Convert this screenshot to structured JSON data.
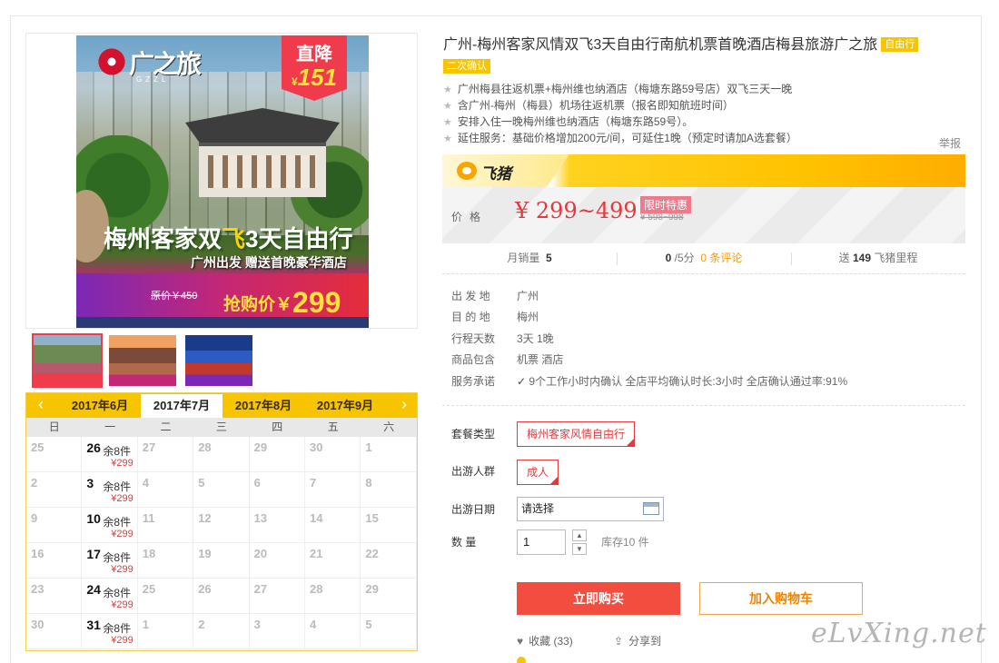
{
  "gallery": {
    "logo_text": "广之旅",
    "logo_sub": "GZZL",
    "promo_top": "直降",
    "promo_value": "151",
    "promo_currency": "¥",
    "headline_part1": "梅州客家双",
    "headline_part2": "飞",
    "headline_part3": "3天自由行",
    "subline": "广州出发 赠送首晚豪华酒店",
    "orig_price": "原价￥450",
    "buy_prefix": "抢购价￥",
    "buy_value": "299"
  },
  "calendar": {
    "prev_label": "‹",
    "next_label": "›",
    "months": [
      "2017年6月",
      "2017年7月",
      "2017年8月",
      "2017年9月"
    ],
    "active_month_index": 1,
    "weekdays": [
      "日",
      "一",
      "二",
      "三",
      "四",
      "五",
      "六"
    ],
    "weeks": [
      [
        {
          "d": "25"
        },
        {
          "d": "26",
          "stock": "余8件",
          "price": "¥299"
        },
        {
          "d": "27"
        },
        {
          "d": "28"
        },
        {
          "d": "29"
        },
        {
          "d": "30"
        },
        {
          "d": "1"
        }
      ],
      [
        {
          "d": "2"
        },
        {
          "d": "3",
          "stock": "余8件",
          "price": "¥299"
        },
        {
          "d": "4"
        },
        {
          "d": "5"
        },
        {
          "d": "6"
        },
        {
          "d": "7"
        },
        {
          "d": "8"
        }
      ],
      [
        {
          "d": "9"
        },
        {
          "d": "10",
          "stock": "余8件",
          "price": "¥299"
        },
        {
          "d": "11"
        },
        {
          "d": "12"
        },
        {
          "d": "13"
        },
        {
          "d": "14"
        },
        {
          "d": "15"
        }
      ],
      [
        {
          "d": "16"
        },
        {
          "d": "17",
          "stock": "余8件",
          "price": "¥299"
        },
        {
          "d": "18"
        },
        {
          "d": "19"
        },
        {
          "d": "20"
        },
        {
          "d": "21"
        },
        {
          "d": "22"
        }
      ],
      [
        {
          "d": "23"
        },
        {
          "d": "24",
          "stock": "余8件",
          "price": "¥299"
        },
        {
          "d": "25"
        },
        {
          "d": "26"
        },
        {
          "d": "27"
        },
        {
          "d": "28"
        },
        {
          "d": "29"
        }
      ],
      [
        {
          "d": "30"
        },
        {
          "d": "31",
          "stock": "余8件",
          "price": "¥299"
        },
        {
          "d": "1"
        },
        {
          "d": "2"
        },
        {
          "d": "3"
        },
        {
          "d": "4"
        },
        {
          "d": "5"
        }
      ]
    ]
  },
  "product": {
    "title": "广州-梅州客家风情双飞3天自由行南航机票首晚酒店梅县旅游广之旅",
    "tag1": "自由行",
    "tag2": "二次确认",
    "features": [
      "广州梅县往返机票+梅州维也纳酒店（梅塘东路59号店）双飞三天一晚",
      "含广州-梅州（梅县）机场往返机票（报名即知航班时间）",
      "安排入住一晚梅州维也纳酒店（梅塘东路59号）。",
      "延住服务：基础价格增加200元/间，可延住1晚（预定时请加A选套餐）"
    ],
    "report": "举报",
    "platform": "飞猪"
  },
  "price": {
    "label": "价格",
    "value": "¥ 299~499",
    "badge": "限时特惠",
    "old": "¥ 598~998"
  },
  "stats": {
    "sales_label": "月销量",
    "sales_value": "5",
    "rating_value": "0",
    "rating_unit": "/5分",
    "reviews": "0 条评论",
    "miles_prefix": "送",
    "miles_value": "149",
    "miles_unit": "飞猪里程"
  },
  "info": {
    "rows": [
      {
        "k": "出 发 地",
        "v": "广州"
      },
      {
        "k": "目 的 地",
        "v": "梅州"
      },
      {
        "k": "行程天数",
        "v": "3天 1晚"
      },
      {
        "k": "商品包含",
        "v": "机票  酒店"
      },
      {
        "k": "服务承诺",
        "v": "9个工作小时内确认    全店平均确认时长:3小时    全店确认通过率:91%"
      }
    ]
  },
  "options": {
    "package_label": "套餐类型",
    "package_value": "梅州客家风情自由行",
    "crowd_label": "出游人群",
    "crowd_value": "成人",
    "date_label": "出游日期",
    "date_value": "请选择",
    "qty_label": "数    量",
    "qty_value": "1",
    "stock_text": "库存10 件"
  },
  "actions": {
    "buy": "立即购买",
    "cart": "加入购物车",
    "favorite": "收藏 (33)",
    "share": "分享到"
  },
  "watermark": "eLvXing.net",
  "colors": {
    "accent_red": "#e4393c",
    "fliggy_yellow": "#f7c500",
    "buy_button": "#f24d3e"
  }
}
